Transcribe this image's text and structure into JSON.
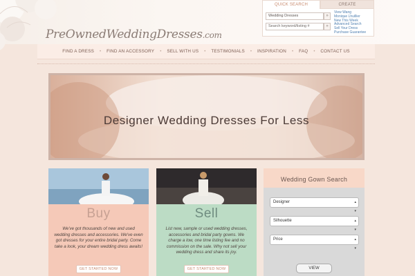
{
  "header": {
    "logo_main": "PreOwnedWeddingDresses",
    "logo_tld": ".com"
  },
  "toolbox": {
    "tabs": [
      "Quick Search",
      "Create Account/Login"
    ],
    "category_select": "Wedding Dresses",
    "search_placeholder": "Search keyword/listing #",
    "go_glyph": "»",
    "quick_links": [
      "View Wang",
      "Monique Lhuillier",
      "New This Week",
      "Advanced Search",
      "Sell Your Dress",
      "Purchase Guarantee"
    ]
  },
  "nav": {
    "items": [
      "Find a Dress",
      "Find an Accessory",
      "Sell With Us",
      "Testimonials",
      "Inspiration",
      "FAQ",
      "Contact Us"
    ],
    "separator": "•"
  },
  "hero": {
    "title": "Designer Wedding Dresses For Less"
  },
  "cards": {
    "buy": {
      "title": "Buy",
      "description": "We've got thousands of new and used wedding dresses and accessories. We've even got dresses for your entire bridal party. Come take a look, your dream wedding dress awaits!",
      "button": "Get Started Now"
    },
    "sell": {
      "title": "Sell",
      "description": "List new, sample or used wedding dresses, accessories and bridal party gowns. We charge a low, one time listing fee and no commission on the sale. Why not sell your wedding dress and share its joy.",
      "button": "Get Started Now"
    }
  },
  "gown_search": {
    "title": "Wedding Gown Search",
    "dropdowns": [
      "Designer",
      "Silhouette",
      "Price"
    ],
    "button": "View"
  },
  "colors": {
    "page_bg": "#f5e6dd",
    "buy_panel": "#f5c9b8",
    "sell_panel": "#bcdcc5",
    "accent_text": "#c88a6e"
  }
}
